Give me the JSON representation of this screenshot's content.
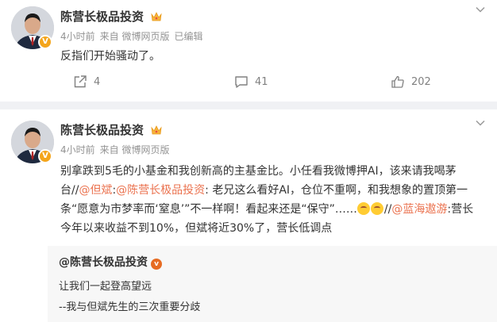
{
  "posts": [
    {
      "author": "陈营长极品投资",
      "time": "4小时前",
      "source": "来自 微博网页版",
      "edited": "已编辑",
      "content": "反指们开始骚动了。",
      "repost_count": "4",
      "comment_count": "41",
      "like_count": "202"
    },
    {
      "author": "陈营长极品投资",
      "time": "4小时前",
      "source": "来自 微博网页版",
      "content": {
        "part1": "别拿跌到5毛的小基金和我创新高的主基金比。小任看我微博押AI，该来请我喝茅台//",
        "mention1": "@但斌",
        "colon1": ":",
        "mention2": "@陈营长极品投资",
        "part2": ": 老兄这么看好AI，仓位不重啊，和我想象的置顶第一条“愿意为市梦率而‘窒息’”不一样啊！看起来还是“保守”……",
        "part3": "//",
        "mention3": "@蓝海遨游",
        "part4": ":营长今年以来收益不到10%，但斌将近30%了，营长低调点"
      },
      "quote": {
        "author": "@陈营长极品投资",
        "line1": "让我们一起登高望远",
        "line2": "--我与但斌先生的三次重要分歧"
      }
    }
  ],
  "colors": {
    "link": "#eb7350",
    "meta": "#939393",
    "verified_badge": "#f4a51c"
  },
  "icons": [
    "crown-icon",
    "verified-icon",
    "chevron-down-icon",
    "repost-icon",
    "comment-icon",
    "like-icon",
    "laugh-emoji-icon",
    "cry-laugh-emoji-icon"
  ]
}
